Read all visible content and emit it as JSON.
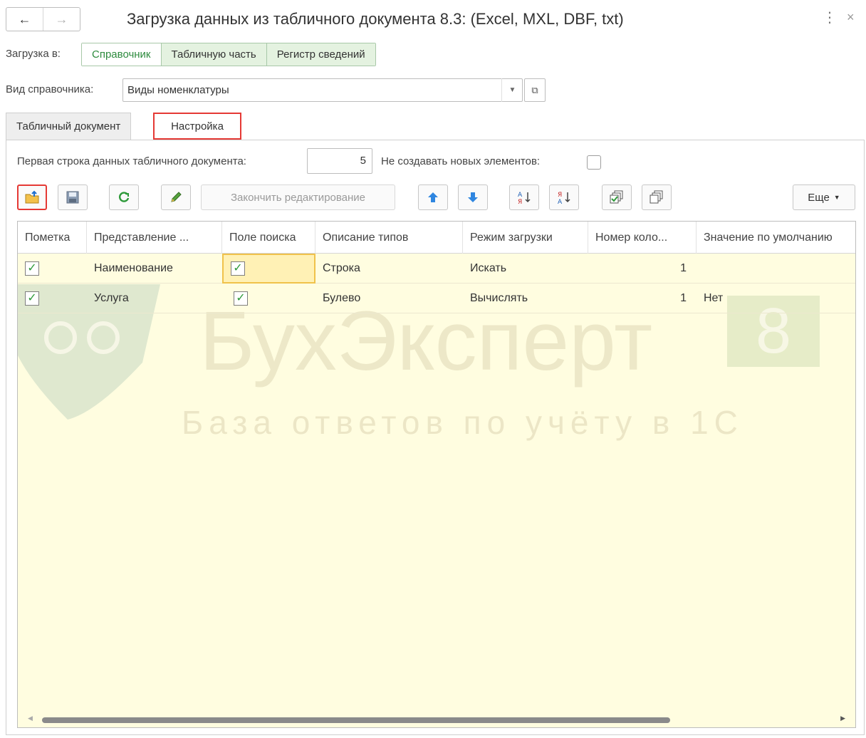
{
  "window": {
    "title": "Загрузка данных из табличного документа 8.3: (Excel, MXL, DBF, txt)",
    "back_icon": "←",
    "forward_icon": "→",
    "menu_icon": "⋮",
    "close_icon": "×"
  },
  "load_to": {
    "label": "Загрузка в:",
    "options": [
      "Справочник",
      "Табличную часть",
      "Регистр сведений"
    ],
    "selected": "Справочник"
  },
  "catalog_kind": {
    "label": "Вид справочника:",
    "value": "Виды номенклатуры"
  },
  "tabs": [
    {
      "label": "Табличный документ"
    },
    {
      "label": "Настройка"
    }
  ],
  "settings": {
    "first_row_label": "Первая строка данных табличного документа:",
    "first_row_value": "5",
    "no_new_label": "Не создавать новых элементов:",
    "no_new_checked": false
  },
  "toolbar": {
    "finish_edit": "Закончить редактирование",
    "more": "Еще",
    "icons": [
      "open-file-icon",
      "save-icon",
      "refresh-icon",
      "edit-icon",
      "move-up-icon",
      "move-down-icon",
      "sort-asc-icon",
      "sort-desc-icon",
      "check-all-icon",
      "uncheck-all-icon"
    ]
  },
  "grid": {
    "columns": [
      "Пометка",
      "Представление ...",
      "Поле поиска",
      "Описание типов",
      "Режим загрузки",
      "Номер коло...",
      "Значение по умолчанию"
    ],
    "rows": [
      {
        "mark": true,
        "name": "Наименование",
        "search": true,
        "type": "Строка",
        "mode": "Искать",
        "col": "1",
        "default": ""
      },
      {
        "mark": true,
        "name": "Услуга",
        "search": true,
        "type": "Булево",
        "mode": "Вычислять",
        "col": "1",
        "default": "Нет"
      }
    ]
  },
  "watermark": {
    "title": "БухЭксперт",
    "digit": "8",
    "subtitle": "База ответов по учёту в 1С"
  },
  "colors": {
    "accent_red": "#e53935",
    "accent_green": "#2e8b3e",
    "row_yellow": "#fffde0"
  }
}
